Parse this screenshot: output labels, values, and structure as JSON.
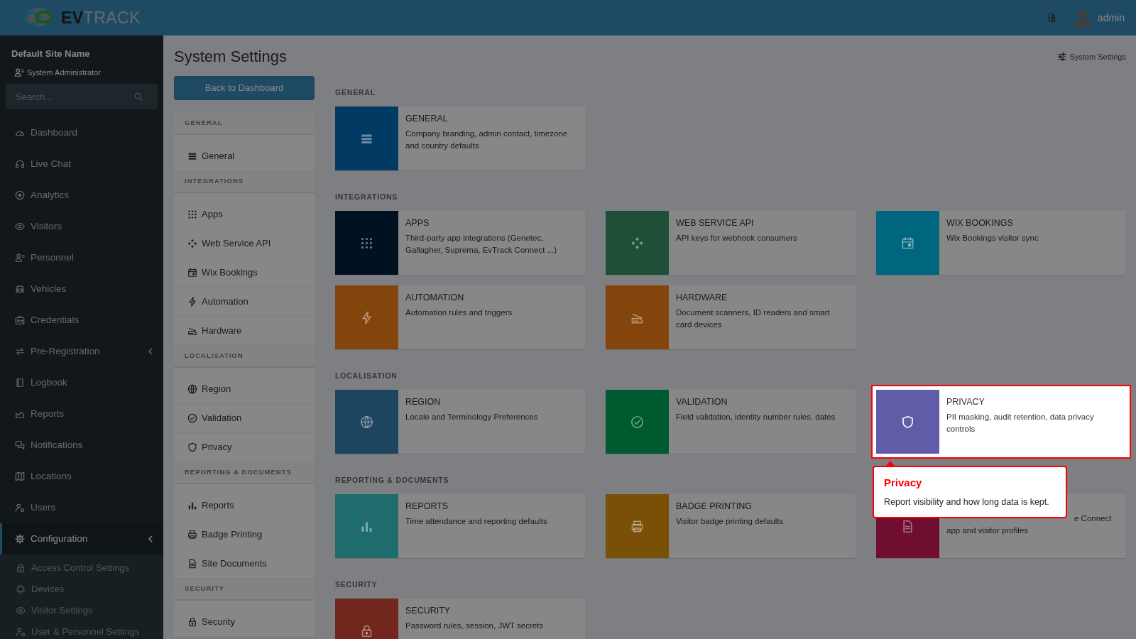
{
  "header": {
    "logo": "**EV**TRACK",
    "user": "admin"
  },
  "sidebar": {
    "site_name": "Default Site Name",
    "role": "System Administrator",
    "search": {
      "placeholder": "Search..."
    },
    "items": [
      {
        "label": "Dashboard",
        "selected": false,
        "collapsible": false
      },
      {
        "label": "Live Chat",
        "selected": false,
        "collapsible": false
      },
      {
        "label": "Analytics",
        "selected": false,
        "collapsible": false
      },
      {
        "label": "Visitors",
        "selected": false,
        "collapsible": false
      },
      {
        "label": "Personnel",
        "selected": false,
        "collapsible": false
      },
      {
        "label": "Vehicles",
        "selected": false,
        "collapsible": false
      },
      {
        "label": "Credentials",
        "selected": false,
        "collapsible": false
      },
      {
        "label": "Pre-Registration",
        "selected": false,
        "collapsible": true
      },
      {
        "label": "Logbook",
        "selected": false,
        "collapsible": false
      },
      {
        "label": "Reports",
        "selected": false,
        "collapsible": false
      },
      {
        "label": "Notifications",
        "selected": false,
        "collapsible": false
      },
      {
        "label": "Locations",
        "selected": false,
        "collapsible": false
      },
      {
        "label": "Users",
        "selected": false,
        "collapsible": false
      },
      {
        "label": "Configuration",
        "selected": true,
        "collapsible": true,
        "children": [
          {
            "label": "Access Control Settings"
          },
          {
            "label": "Devices"
          },
          {
            "label": "Visitor Settings"
          },
          {
            "label": "User & Personnel Settings"
          }
        ]
      }
    ]
  },
  "page": {
    "title": "System Settings",
    "breadcrumb": "System Settings",
    "back_button": "Back to Dashboard"
  },
  "settings_nav": [
    {
      "heading": "GENERAL",
      "items": [
        "General"
      ]
    },
    {
      "heading": "INTEGRATIONS",
      "items": [
        "Apps",
        "Web Service API",
        "Wix Bookings",
        "Automation",
        "Hardware"
      ]
    },
    {
      "heading": "LOCALISATION",
      "items": [
        "Region",
        "Validation",
        "Privacy"
      ]
    },
    {
      "heading": "REPORTING & DOCUMENTS",
      "items": [
        "Reports",
        "Badge Printing",
        "Site Documents"
      ]
    },
    {
      "heading": "SECURITY",
      "items": [
        "Security"
      ]
    }
  ],
  "sections": [
    {
      "heading": "GENERAL",
      "cards": [
        {
          "title": "GENERAL",
          "description": "Company branding, admin contact, timezone and country defaults",
          "color": "#013a63",
          "highlighted": false
        }
      ]
    },
    {
      "heading": "INTEGRATIONS",
      "cards": [
        {
          "title": "APPS",
          "description": "Third-party app integrations (Genetec, Gallagher, Suprema, EvTrack Connect ...)",
          "color": "#001122",
          "highlighted": false
        },
        {
          "title": "WEB SERVICE API",
          "description": "API keys for webhook consumers",
          "color": "#1e5038",
          "highlighted": false
        },
        {
          "title": "WIX BOOKINGS",
          "description": "Wix Bookings visitor sync",
          "color": "#006680",
          "highlighted": false
        },
        {
          "title": "AUTOMATION",
          "description": "Automation rules and triggers",
          "color": "#84450c",
          "highlighted": false
        },
        {
          "title": "HARDWARE",
          "description": "Document scanners, ID readers and smart card devices",
          "color": "#84450c",
          "highlighted": false
        }
      ]
    },
    {
      "heading": "LOCALISATION",
      "cards": [
        {
          "title": "REGION",
          "description": "Locale and Terminology Preferences",
          "color": "#1e4560",
          "highlighted": false
        },
        {
          "title": "VALIDATION",
          "description": "Field validation, identity number rules, dates",
          "color": "#005a30",
          "highlighted": false
        },
        {
          "title": "PRIVACY",
          "description": "PII masking, audit retention, data privacy controls",
          "color": "#605ca8",
          "highlighted": true
        }
      ]
    },
    {
      "heading": "REPORTING & DOCUMENTS",
      "cards": [
        {
          "title": "REPORTS",
          "description": "Time attendance and reporting defaults",
          "color": "#1e6c6c",
          "highlighted": false
        },
        {
          "title": "BADGE PRINTING",
          "description": "Visitor badge printing defaults",
          "color": "#7a5008",
          "highlighted": false
        },
        {
          "fragments": [
            "e Connect",
            "app and visitor profiles"
          ],
          "color": "#6f0e2f",
          "highlighted": false
        }
      ]
    },
    {
      "heading": "SECURITY",
      "cards": [
        {
          "title": "SECURITY",
          "description": "Password rules, session, JWT secrets",
          "color": "#72261e",
          "highlighted": false
        }
      ]
    }
  ],
  "tour": {
    "title": "Privacy",
    "text": "Report visibility and how long data is kept."
  }
}
